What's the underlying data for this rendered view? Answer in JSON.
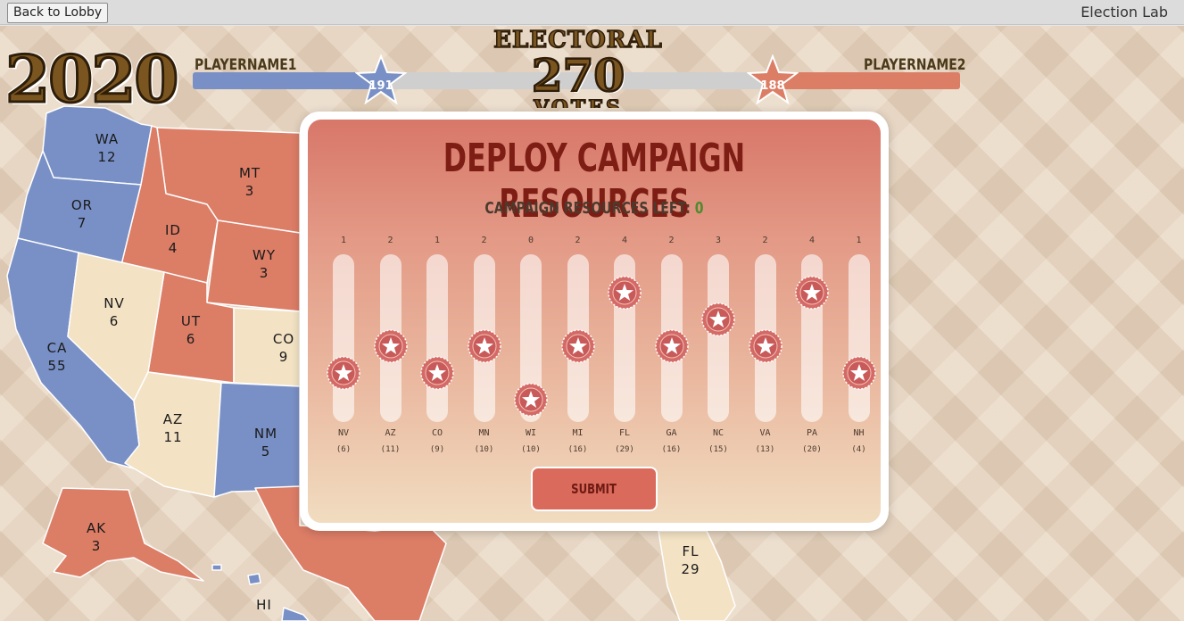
{
  "topbar": {
    "back_label": "Back to Lobby",
    "app_title": "Election Lab"
  },
  "header": {
    "year": "2020",
    "electoral_top": "ELECTORAL",
    "electoral_number": "270",
    "electoral_bottom": "VOTES",
    "player1": {
      "name": "PLAYERNAME1",
      "score": "191",
      "color": "#7990c6"
    },
    "player2": {
      "name": "PLAYERNAME2",
      "score": "188",
      "color": "#dc7d66"
    }
  },
  "map": {
    "colors": {
      "blue": "#7990c6",
      "red": "#dc7d66",
      "neutral": "#f3e2c4"
    },
    "states": [
      {
        "abbr": "WA",
        "votes": "12",
        "party": "blue"
      },
      {
        "abbr": "OR",
        "votes": "7",
        "party": "blue"
      },
      {
        "abbr": "CA",
        "votes": "55",
        "party": "blue"
      },
      {
        "abbr": "MT",
        "votes": "3",
        "party": "red"
      },
      {
        "abbr": "ID",
        "votes": "4",
        "party": "red"
      },
      {
        "abbr": "WY",
        "votes": "3",
        "party": "red"
      },
      {
        "abbr": "NV",
        "votes": "6",
        "party": "neutral"
      },
      {
        "abbr": "UT",
        "votes": "6",
        "party": "red"
      },
      {
        "abbr": "CO",
        "votes": "9",
        "party": "neutral"
      },
      {
        "abbr": "AZ",
        "votes": "11",
        "party": "neutral"
      },
      {
        "abbr": "NM",
        "votes": "5",
        "party": "blue"
      },
      {
        "abbr": "AK",
        "votes": "3",
        "party": "red"
      },
      {
        "abbr": "HI",
        "votes": "",
        "party": "blue"
      },
      {
        "abbr": "FL",
        "votes": "29",
        "party": "neutral"
      }
    ]
  },
  "modal": {
    "title": "DEPLOY CAMPAIGN RESOURCES",
    "resources_left_label": "CAMPAIGN RESOURCES LEFT:",
    "resources_left_value": "0",
    "max_per_state": 6,
    "sliders": [
      {
        "state": "NV",
        "ev": "(6)",
        "value": 1
      },
      {
        "state": "AZ",
        "ev": "(11)",
        "value": 2
      },
      {
        "state": "CO",
        "ev": "(9)",
        "value": 1
      },
      {
        "state": "MN",
        "ev": "(10)",
        "value": 2
      },
      {
        "state": "WI",
        "ev": "(10)",
        "value": 0
      },
      {
        "state": "MI",
        "ev": "(16)",
        "value": 2
      },
      {
        "state": "FL",
        "ev": "(29)",
        "value": 4
      },
      {
        "state": "GA",
        "ev": "(16)",
        "value": 2
      },
      {
        "state": "NC",
        "ev": "(15)",
        "value": 3
      },
      {
        "state": "VA",
        "ev": "(13)",
        "value": 2
      },
      {
        "state": "PA",
        "ev": "(20)",
        "value": 4
      },
      {
        "state": "NH",
        "ev": "(4)",
        "value": 1
      }
    ],
    "submit_label": "SUBMIT"
  }
}
